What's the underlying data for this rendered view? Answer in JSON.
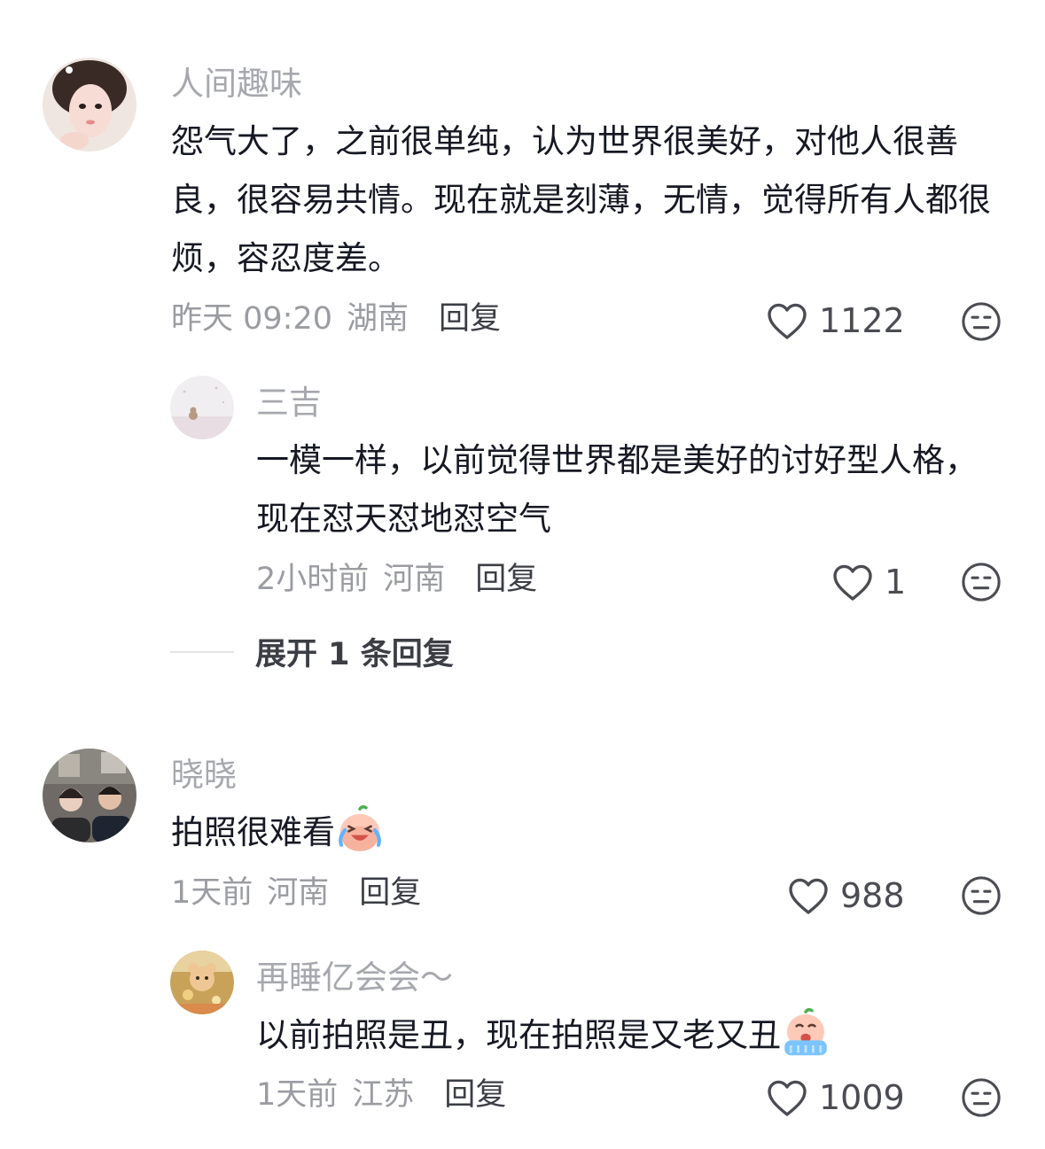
{
  "comments": [
    {
      "username": "人间趣味",
      "text": "怨气大了，之前很单纯，认为世界很美好，对他人很善良，很容易共情。现在就是刻薄，无情，觉得所有人都很烦，容忍度差。",
      "time": "昨天 09:20",
      "location": "湖南",
      "reply_label": "回复",
      "likes": "1122",
      "replies": [
        {
          "username": "三吉",
          "text": "一模一样，以前觉得世界都是美好的讨好型人格，现在怼天怼地怼空气",
          "time": "2小时前",
          "location": "河南",
          "reply_label": "回复",
          "likes": "1"
        }
      ],
      "expand_label": "展开 1 条回复"
    },
    {
      "username": "晓晓",
      "text": "拍照很难看",
      "emoji": "crying-laugh-emoji",
      "time": "1天前",
      "location": "河南",
      "reply_label": "回复",
      "likes": "988",
      "replies": [
        {
          "username": "再睡亿会会～",
          "text": "以前拍照是丑，现在拍照是又老又丑",
          "emoji": "crying-emoji",
          "time": "1天前",
          "location": "江苏",
          "reply_label": "回复",
          "likes": "1009"
        }
      ]
    }
  ],
  "icons": {
    "like": "heart-outline-icon",
    "dislike": "meh-face-icon"
  },
  "colors": {
    "text": "#161823",
    "username": "#a6a8ad",
    "meta": "#9a9ca1",
    "icon": "#4a4c52"
  }
}
